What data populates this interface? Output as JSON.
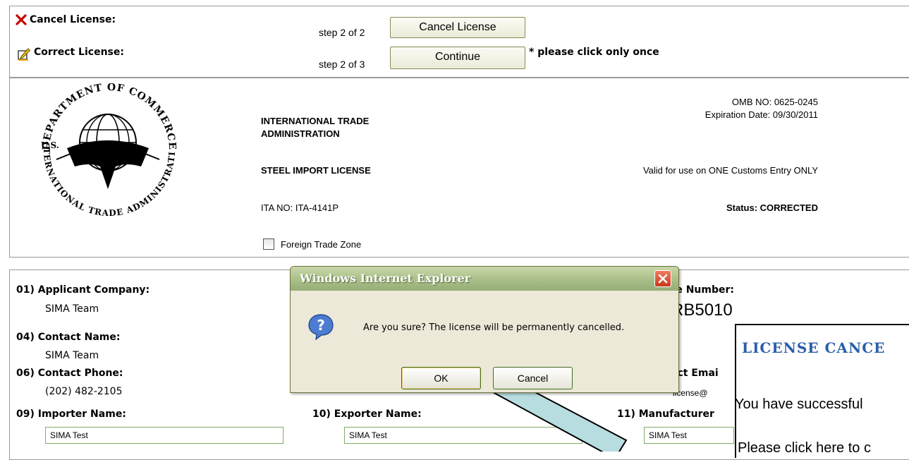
{
  "header": {
    "cancel_label": "Cancel License:",
    "cancel_step": "step 2 of 2",
    "cancel_button": "Cancel License",
    "correct_label": "Correct License:",
    "correct_step": "step 2 of 3",
    "continue_button": "Continue",
    "click_note": "* please click only once"
  },
  "license": {
    "agency_line1": "INTERNATIONAL TRADE",
    "agency_line2": "ADMINISTRATION",
    "omb": "OMB NO: 0625-0245",
    "expiration": "Expiration Date: 09/30/2011",
    "title": "STEEL IMPORT LICENSE",
    "validity": "Valid for use on ONE Customs Entry ONLY",
    "ita_no": "ITA NO: ITA-4141P",
    "status": "Status: CORRECTED",
    "ftz_label": "Foreign Trade Zone",
    "seal_top": "DEPARTMENT OF COMMERCE",
    "seal_left": "U.S.",
    "seal_bottom": "INTERNATIONAL TRADE ADMINISTRATION"
  },
  "fields": {
    "f01_label": "01) Applicant Company:",
    "f01_value": "SIMA Team",
    "f04_label": "04) Contact Name:",
    "f04_value": "SIMA Team",
    "f06_label": "06) Contact Phone:",
    "f06_value": "(202) 482-2105",
    "f09_label": "09) Importer Name:",
    "f09_value": "SIMA Test",
    "f10_label": "10) Exporter Name:",
    "f10_value": "SIMA Test",
    "f11_label": "11) Manufacturer",
    "f11_value": "SIMA Test",
    "license_number_label": "se Number:",
    "license_number_value": "RB5010",
    "contact_email_label": "act Emai",
    "contact_email_value": "license@"
  },
  "dialog": {
    "title": "Windows Internet Explorer",
    "message": "Are you sure? The license will be permanently cancelled.",
    "ok": "OK",
    "cancel": "Cancel"
  },
  "overlay": {
    "heading": "LICENSE CANCE",
    "text1": "You have successful",
    "text2": "Please click here to c"
  },
  "colors": {
    "cancel_x": "#cc0000",
    "dialog_title_bg": "#a7bd86",
    "dialog_close": "#d9442a",
    "overlay_heading": "#2b5fa8",
    "arrow_fill": "#b8dde0"
  }
}
